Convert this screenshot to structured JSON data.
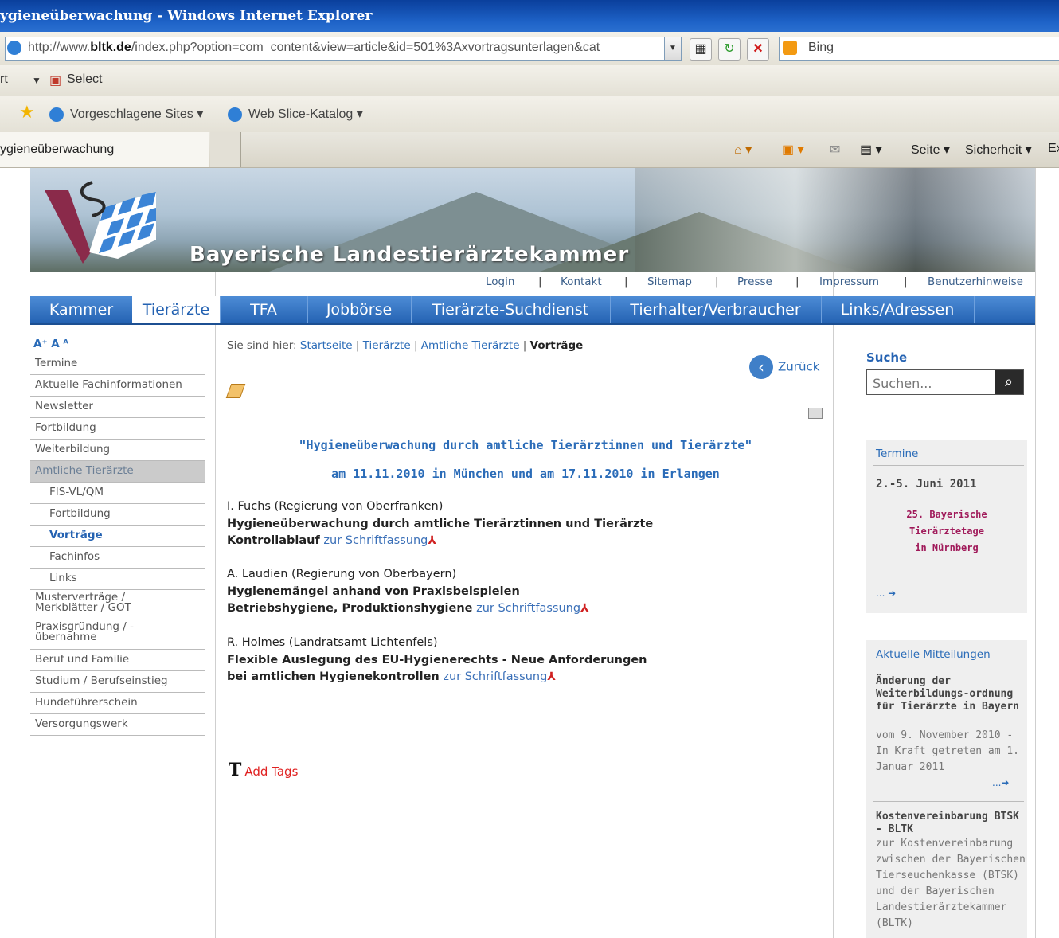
{
  "window": {
    "title": "ygieneüberwachung - Windows Internet Explorer"
  },
  "address_bar": {
    "url_prefix": "http://www.",
    "url_domain": "bltk.de",
    "url_rest": "/index.php?option=com_content&view=article&id=501%3Axvortragsunterlagen&cat",
    "search_engine": "Bing"
  },
  "menu_bar": {
    "item_partial": "rt",
    "select_label": "Select"
  },
  "favorites_bar": {
    "suggested_sites": "Vorgeschlagene Sites",
    "web_slice": "Web Slice-Katalog"
  },
  "tab_bar": {
    "active_tab": "ygieneüberwachung"
  },
  "command_bar": {
    "page": "Seite",
    "security": "Sicherheit",
    "extra": "Ex"
  },
  "site": {
    "title": "Bayerische Landestierärztekammer",
    "top_links": [
      "Login",
      "Kontakt",
      "Sitemap",
      "Presse",
      "Impressum",
      "Benutzerhinweise"
    ],
    "nav": [
      "Kammer",
      "Tierärzte",
      "TFA",
      "Jobbörse",
      "Tierärzte-Suchdienst",
      "Tierhalter/Verbraucher",
      "Links/Adressen"
    ],
    "nav_active": "Tierärzte"
  },
  "left_menu": {
    "font_size_label": "A⁺ A ᴬ",
    "items": [
      "Termine",
      "Aktuelle Fachinformationen",
      "Newsletter",
      "Fortbildung",
      "Weiterbildung",
      "Amtliche Tierärzte",
      "FIS-VL/QM",
      "Fortbildung",
      "Vorträge",
      "Fachinfos",
      "Links",
      "Musterverträge /\nMerkblätter / GOT",
      "Praxisgründung / -\nübernahme",
      "Beruf und Familie",
      "Studium / Berufseinstieg",
      "Hundeführerschein",
      "Versorgungswerk"
    ]
  },
  "content": {
    "breadcrumb_prefix": "Sie sind hier:",
    "breadcrumb": [
      "Startseite",
      "Tierärzte",
      "Amtliche Tierärzte",
      "Vorträge"
    ],
    "back_label": "Zurück",
    "heading1": "\"Hygieneüberwachung durch amtliche Tierärztinnen und Tierärzte\"",
    "heading2": "am 11.11.2010 in München und am 17.11.2010 in Erlangen",
    "talks": [
      {
        "speaker": "I. Fuchs (Regierung von Oberfranken)",
        "line1": "Hygieneüberwachung durch amtliche Tierärztinnen und Tierärzte",
        "line2": "Kontrollablauf",
        "link": "zur Schriftfassung"
      },
      {
        "speaker": "A. Laudien (Regierung von Oberbayern)",
        "line1": "Hygienemängel anhand von Praxisbeispielen",
        "line2": "Betriebshygiene, Produktionshygiene",
        "link": "zur Schriftfassung"
      },
      {
        "speaker": "R. Holmes (Landratsamt Lichtenfels)",
        "line1": "Flexible Auslegung des EU-Hygienerechts - Neue Anforderungen",
        "line2": "bei amtlichen Hygienekontrollen",
        "link": "zur Schriftfassung"
      }
    ],
    "tags_label": "Add Tags"
  },
  "sidebar": {
    "search_title": "Suche",
    "search_placeholder": "Suchen...",
    "termine": {
      "title": "Termine",
      "date": "2.-5. Juni 2011",
      "event": [
        "25. Bayerische",
        "Tierärztetage",
        "in Nürnberg"
      ],
      "more": "... ➜"
    },
    "news": {
      "title": "Aktuelle Mitteilungen",
      "items": [
        {
          "title": "Änderung der Weiterbildungs-ordnung für Tierärzte in Bayern",
          "text": "vom 9. November 2010 - In Kraft getreten am 1. Januar 2011",
          "more": "...➜"
        },
        {
          "title": "Kostenvereinbarung BTSK - BLTK",
          "text": "zur Kostenvereinbarung zwischen der Bayerischen Tierseuchenkasse (BTSK) und der Bayerischen Landestierärztekammer (BLTK)"
        }
      ]
    }
  }
}
